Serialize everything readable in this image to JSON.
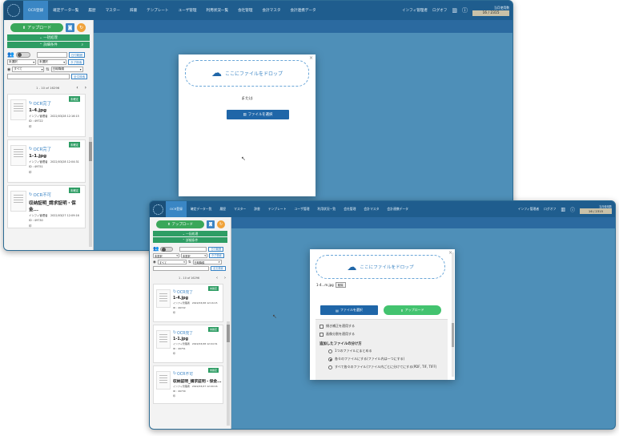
{
  "header": {
    "nav": [
      "OCR登録",
      "確定データ一覧",
      "履歴",
      "マスター",
      "辞書",
      "テンプレート",
      "ユーザ管理",
      "利用状況一覧",
      "会社管理",
      "会計マスタ",
      "会計連携データ"
    ],
    "user": "インフィ管理者",
    "logout": "ログオフ",
    "usage_label": "当月使用数",
    "usage_value": "16 / 2315"
  },
  "sidebar": {
    "upload": "アップロード",
    "bulk_process": "一括処理",
    "detail_conditions": "詳細条件",
    "range_button": "日付範囲",
    "tag_search": "タグ検索",
    "select_unselected": "未選択",
    "select_all": "すべて",
    "select_sort": "日時降順",
    "fulltext_search": "全文検索",
    "pager": "1 - 10 of 16296"
  },
  "cards": [
    {
      "status": "OCR完了",
      "name": "1-4.jpg",
      "meta1": "インフィ管理者　2022/03/28 12:16:15",
      "meta2": "ID : 49722",
      "meta3": "印",
      "badge": "未確定"
    },
    {
      "status": "OCR完了",
      "name": "1-1.jpg",
      "meta1": "インフィ管理者　2022/03/28 12:04:31",
      "meta2": "ID : 49751",
      "meta3": "印",
      "badge": "未確定"
    },
    {
      "status": "OCR不可",
      "name": "収纳証明_請求証明・保金...",
      "meta1": "インフィ管理者　2022/03/27 12:09:16",
      "meta2": "ID : 49730",
      "meta3": "印",
      "badge": "未確定"
    }
  ],
  "modal1": {
    "drop_text": "ここにファイルをドロップ",
    "or_text": "または",
    "select_file": "ファイルを選択"
  },
  "modal2": {
    "drop_text": "ここにファイルをドロップ",
    "file_name": "1-4...m.jpg",
    "remove_label": "削除",
    "select_file": "ファイルを選択",
    "upload": "アップロード",
    "option1": "傾き補正を適用する",
    "option2": "画像分割を適用する",
    "heading": "追加したファイルの分け方",
    "radio1": "1つのファイルにまとめる",
    "radio2": "各々のファイルにする(ファイル内は一つにする)",
    "radio3": "すべて各々のファイル(ファイル内ごとに分けてにする(PDF, TIF, TIFF)"
  },
  "colors": {
    "header": "#1f5d8e",
    "accent_green": "#2e9d64",
    "accent_blue": "#1f66a8",
    "background": "#4e8fb8"
  }
}
